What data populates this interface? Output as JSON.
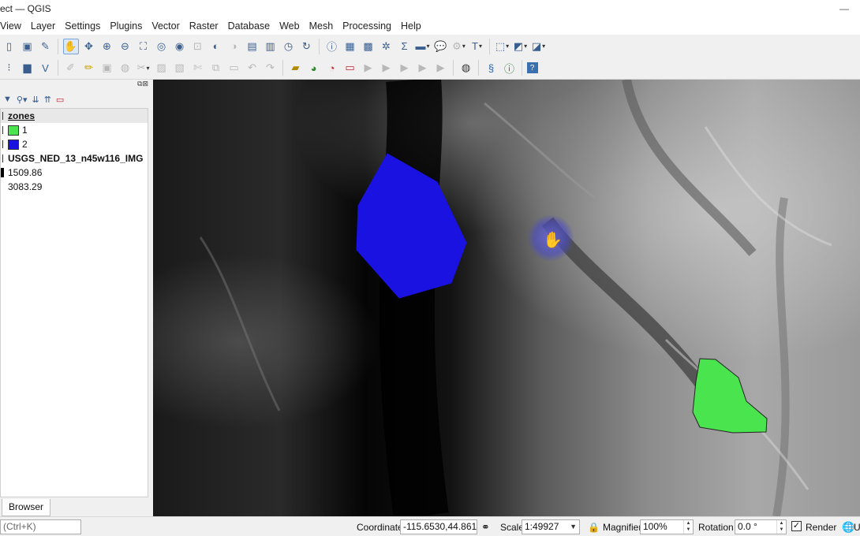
{
  "window": {
    "title": "ect — QGIS",
    "minimize": "—"
  },
  "menu": [
    "View",
    "Layer",
    "Settings",
    "Plugins",
    "Vector",
    "Raster",
    "Database",
    "Web",
    "Mesh",
    "Processing",
    "Help"
  ],
  "toolbar1": {
    "icons": [
      "new-project-icon",
      "save-as-icon",
      "style-manager-icon",
      "pan-icon",
      "pan-to-selection-icon",
      "zoom-in-icon",
      "zoom-out-icon",
      "zoom-full-icon",
      "zoom-selection-icon",
      "zoom-layer-icon",
      "zoom-native-icon",
      "zoom-last-icon",
      "zoom-next-icon",
      "new-bookmark-icon",
      "show-bookmarks-icon",
      "temporal-controller-icon",
      "refresh-icon",
      "identify-icon",
      "attribute-table-icon",
      "field-calculator-icon",
      "statistics-icon",
      "measure-icon",
      "map-tips-icon",
      "select-location-icon",
      "text-annotation-icon",
      "select-features-icon",
      "deselect-icon",
      "select-by-expression-icon"
    ]
  },
  "toolbar2": {
    "icons": [
      "data-source-manager-icon",
      "new-layer-icon",
      "virtual-layer-icon",
      "digitize-icon",
      "edit-pencil-icon",
      "save-edits-icon",
      "add-feature-icon",
      "vertex-tool-icon",
      "delete-icon",
      "cut-icon",
      "copy-icon",
      "paste-icon",
      "undo-icon",
      "redo-icon",
      "label-icon",
      "diagram-icon",
      "pin-label-icon",
      "hide-label-icon",
      "move-label-icon",
      "rotate-label-icon",
      "change-label-icon",
      "label-properties-icon",
      "quickmapservices-icon",
      "python-console-icon",
      "identify-plugin-icon",
      "help-icon"
    ]
  },
  "layers_panel": {
    "rows": [
      {
        "label": "zones",
        "type": "group-header"
      },
      {
        "label": "1",
        "type": "category",
        "color": "#4ae44f"
      },
      {
        "label": "2",
        "type": "category",
        "color": "#1a12e0"
      },
      {
        "label": "USGS_NED_13_n45w116_IMG",
        "type": "raster-header"
      },
      {
        "label": "1509.86",
        "type": "ramp-min"
      },
      {
        "label": "3083.29",
        "type": "ramp-max"
      }
    ]
  },
  "bottom_tab": "Browser",
  "statusbar": {
    "locator_placeholder": "(Ctrl+K)",
    "coordinate_label": "Coordinate",
    "coordinate_value": "-115.6530,44.8611",
    "scale_label": "Scale",
    "scale_value": "1:49927",
    "magnifier_label": "Magnifier",
    "magnifier_value": "100%",
    "rotation_label": "Rotation",
    "rotation_value": "0.0 °",
    "render_label": "Render",
    "render_checked": true,
    "crs_partial": "U"
  },
  "map": {
    "polygon_blue_color": "#1a12e0",
    "polygon_green_color": "#4ae44f"
  }
}
